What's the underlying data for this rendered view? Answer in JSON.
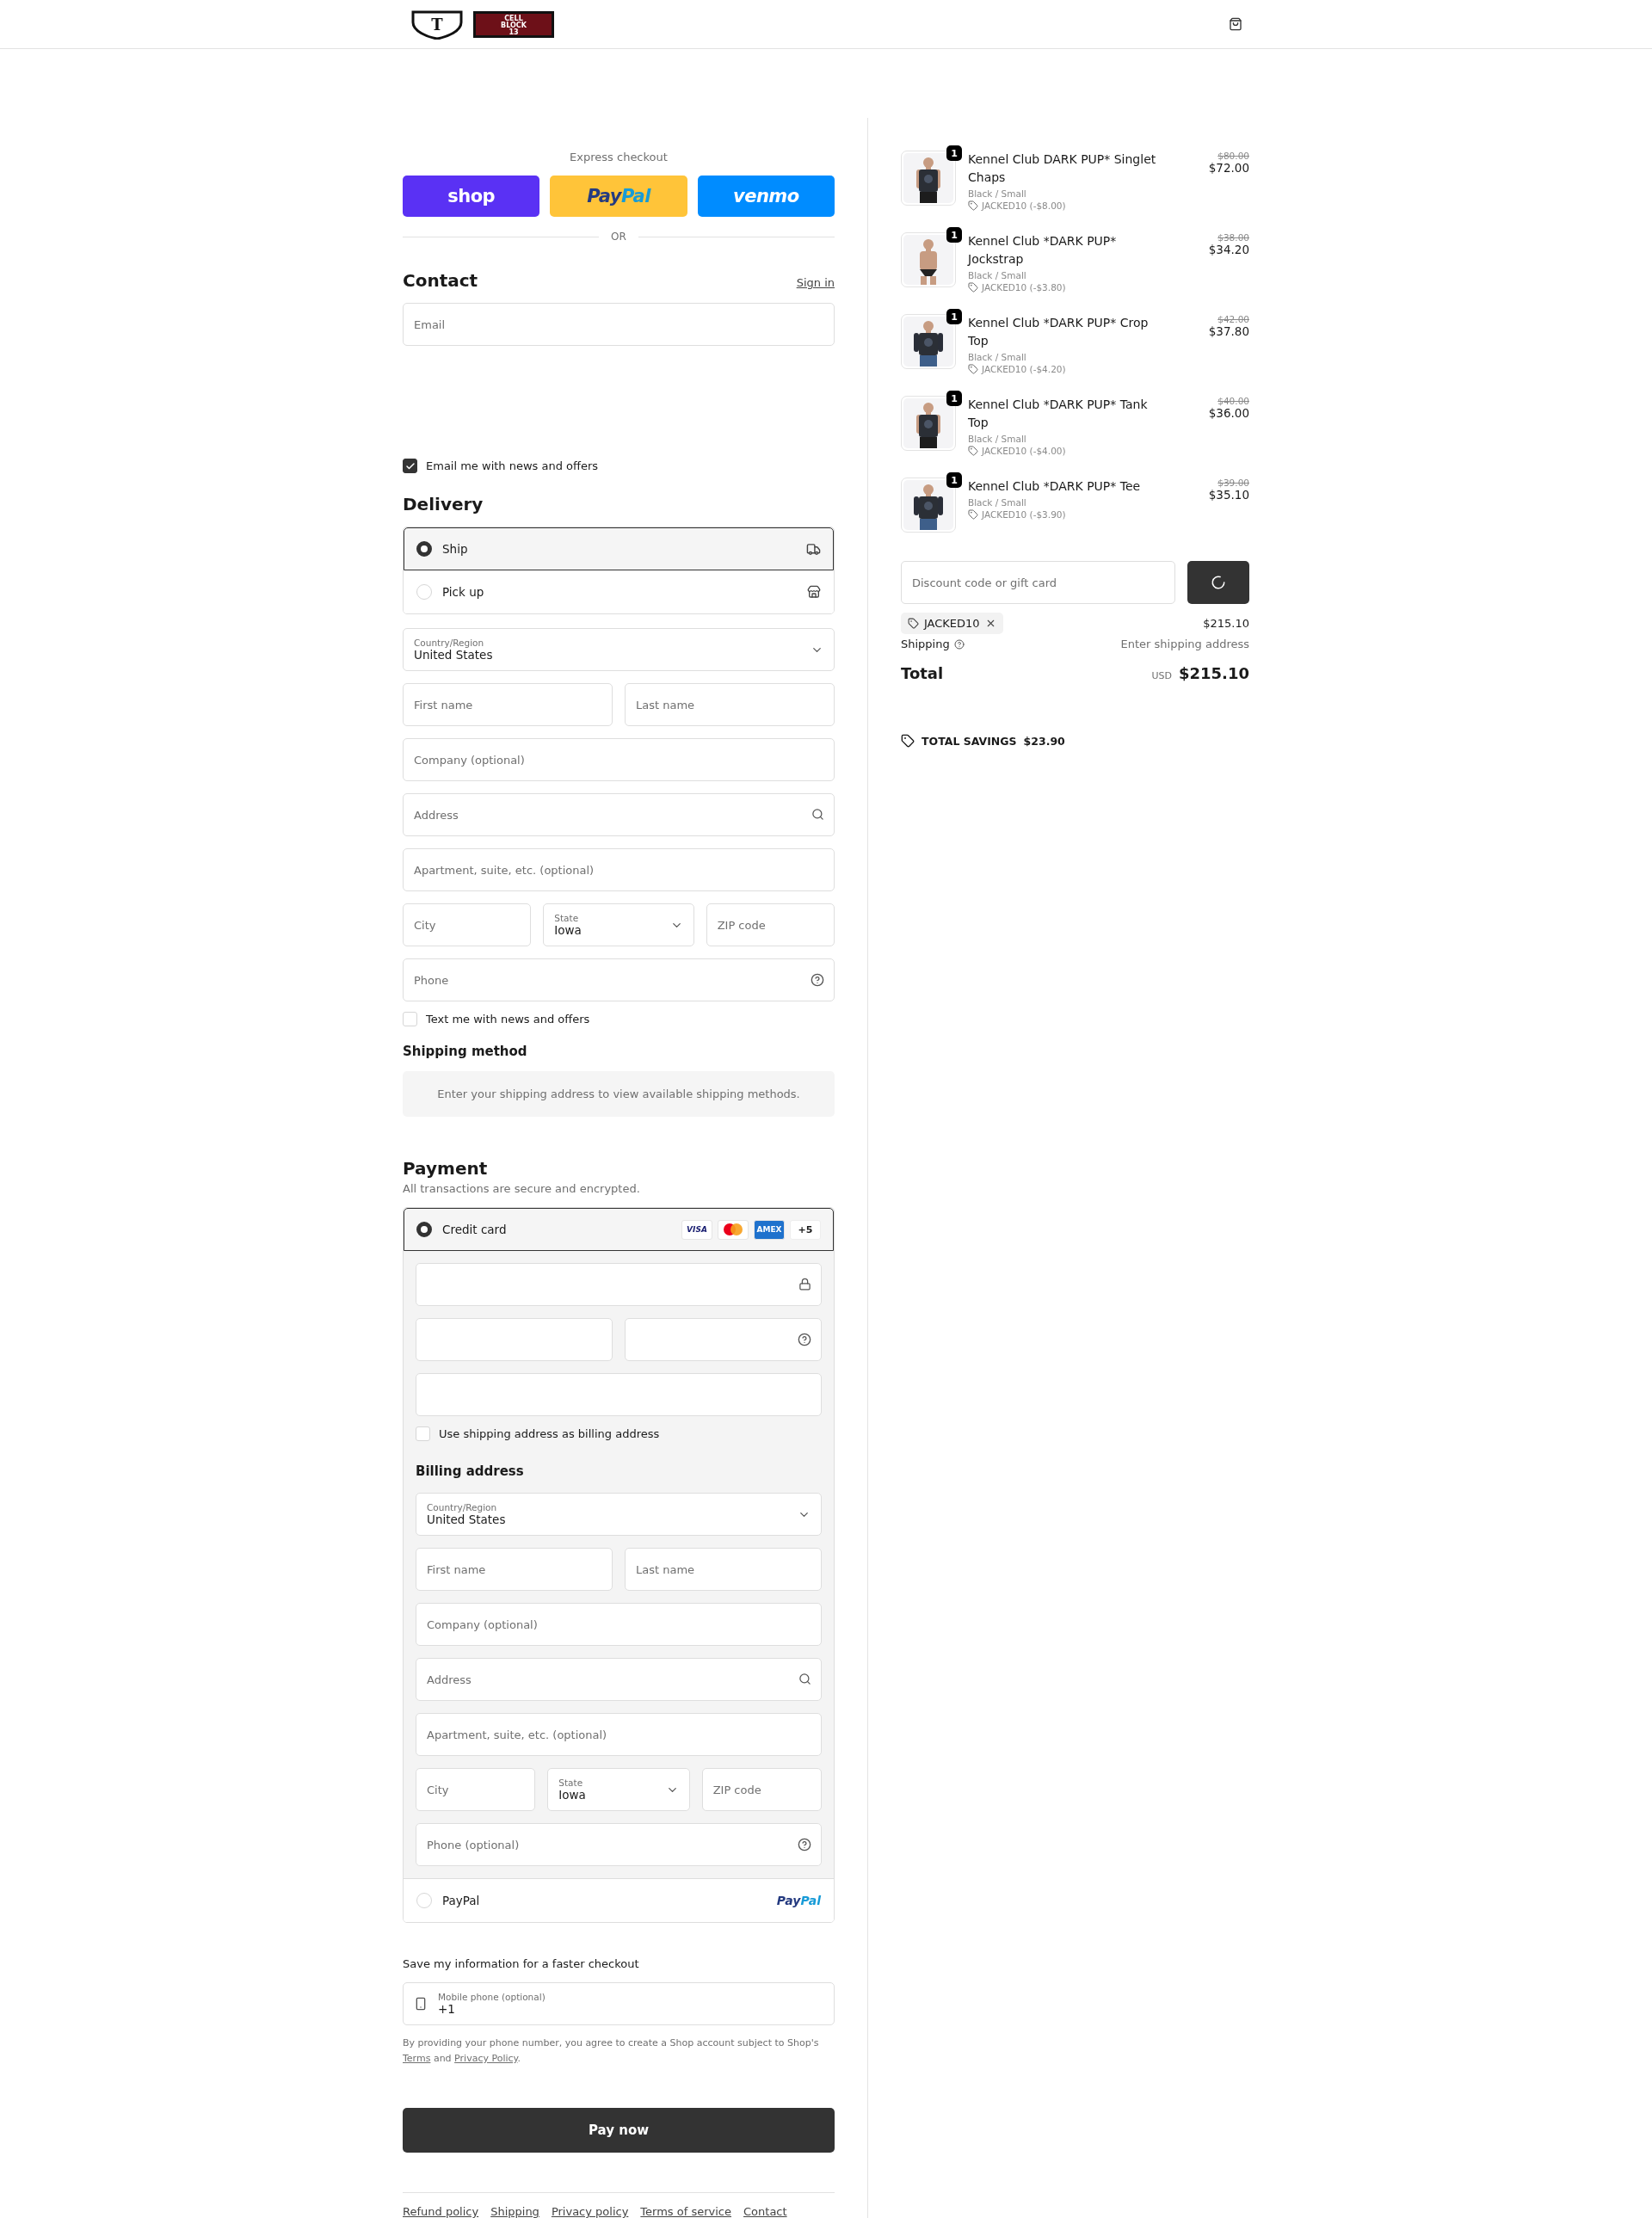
{
  "header": {
    "logo": {
      "emblem": "T",
      "badge": [
        "CELL",
        "BLOCK",
        "13"
      ]
    }
  },
  "express_checkout": {
    "title": "Express checkout",
    "buttons": [
      {
        "kind": "shop",
        "parts": [
          "shop"
        ]
      },
      {
        "kind": "paypal",
        "parts": [
          "Pay",
          "Pal"
        ]
      },
      {
        "kind": "venmo",
        "parts": [
          "venmo"
        ]
      }
    ],
    "divider": "OR"
  },
  "contact": {
    "title": "Contact",
    "sign_in": "Sign in",
    "email": {
      "placeholder": "Email"
    },
    "offers": {
      "label": "Email me with news and offers",
      "checked": true
    }
  },
  "delivery": {
    "title": "Delivery",
    "options": [
      {
        "label": "Ship",
        "kind": "ship",
        "selected": true
      },
      {
        "label": "Pick up",
        "kind": "pickup",
        "selected": false
      }
    ],
    "rows": [
      [
        {
          "kind": "select",
          "label": "Country/Region",
          "value": "United States"
        }
      ],
      [
        {
          "kind": "text",
          "placeholder": "First name"
        },
        {
          "kind": "text",
          "placeholder": "Last name"
        }
      ],
      [
        {
          "kind": "text",
          "placeholder": "Company (optional)"
        }
      ],
      [
        {
          "kind": "search",
          "placeholder": "Address"
        }
      ],
      [
        {
          "kind": "text",
          "placeholder": "Apartment, suite, etc. (optional)"
        }
      ],
      [
        {
          "kind": "text",
          "placeholder": "City"
        },
        {
          "kind": "select",
          "label": "State",
          "value": "Iowa"
        },
        {
          "kind": "text",
          "placeholder": "ZIP code"
        }
      ],
      [
        {
          "kind": "help",
          "placeholder": "Phone"
        }
      ]
    ],
    "text_offers": {
      "label": "Text me with news and offers",
      "checked": false
    }
  },
  "shipping_method": {
    "title": "Shipping method",
    "message": "Enter your shipping address to view available shipping methods."
  },
  "payment": {
    "title": "Payment",
    "subtitle": "All transactions are secure and encrypted.",
    "methods": [
      {
        "kind": "card",
        "label": "Credit card",
        "selected": true,
        "brands": [
          {
            "kind": "visa",
            "label": "VISA"
          },
          {
            "kind": "mastercard"
          },
          {
            "kind": "amex",
            "label": "AMEX"
          }
        ],
        "more": "+5"
      },
      {
        "kind": "paypal",
        "label": "PayPal",
        "selected": false,
        "logo": [
          "Pay",
          "Pal"
        ]
      }
    ],
    "card_rows": [
      [
        {
          "kind": "lock"
        }
      ],
      [
        {
          "kind": "text"
        },
        {
          "kind": "help"
        }
      ],
      [
        {
          "kind": "text"
        }
      ]
    ],
    "same_as_shipping": {
      "label": "Use shipping address as billing address",
      "checked": false
    },
    "billing": {
      "title": "Billing address",
      "rows": [
        [
          {
            "kind": "select",
            "label": "Country/Region",
            "value": "United States"
          }
        ],
        [
          {
            "kind": "text",
            "placeholder": "First name"
          },
          {
            "kind": "text",
            "placeholder": "Last name"
          }
        ],
        [
          {
            "kind": "text",
            "placeholder": "Company (optional)"
          }
        ],
        [
          {
            "kind": "search",
            "placeholder": "Address"
          }
        ],
        [
          {
            "kind": "text",
            "placeholder": "Apartment, suite, etc. (optional)"
          }
        ],
        [
          {
            "kind": "text",
            "placeholder": "City"
          },
          {
            "kind": "select",
            "label": "State",
            "value": "Iowa"
          },
          {
            "kind": "text",
            "placeholder": "ZIP code"
          }
        ],
        [
          {
            "kind": "help",
            "placeholder": "Phone (optional)"
          }
        ]
      ]
    }
  },
  "remember_me": {
    "title": "Save my information for a faster checkout",
    "phone": {
      "label": "Mobile phone (optional)",
      "value": "+1"
    },
    "disclaimer": {
      "before": "By providing your phone number, you agree to create a Shop account subject to Shop's",
      "terms": "Terms",
      "middle": "and",
      "privacy": "Privacy Policy",
      "after": "."
    }
  },
  "pay_button": "Pay now",
  "footer_links": [
    "Refund policy",
    "Shipping",
    "Privacy policy",
    "Terms of service",
    "Contact"
  ],
  "summary": {
    "items": [
      {
        "quantity": "1",
        "name": "Kennel Club DARK PUP* Singlet Chaps",
        "variant": "Black / Small",
        "discount": "JACKED10 (-$8.00)",
        "original_price": "$80.00",
        "price": "$72.00",
        "kind": "singlet"
      },
      {
        "quantity": "1",
        "name": "Kennel Club *DARK PUP* Jockstrap",
        "variant": "Black / Small",
        "discount": "JACKED10 (-$3.80)",
        "original_price": "$38.00",
        "price": "$34.20",
        "kind": "jock"
      },
      {
        "quantity": "1",
        "name": "Kennel Club *DARK PUP* Crop Top",
        "variant": "Black / Small",
        "discount": "JACKED10 (-$4.20)",
        "original_price": "$42.00",
        "price": "$37.80",
        "kind": "tee"
      },
      {
        "quantity": "1",
        "name": "Kennel Club *DARK PUP* Tank Top",
        "variant": "Black / Small",
        "discount": "JACKED10 (-$4.00)",
        "original_price": "$40.00",
        "price": "$36.00",
        "kind": "singlet"
      },
      {
        "quantity": "1",
        "name": "Kennel Club *DARK PUP* Tee",
        "variant": "Black / Small",
        "discount": "JACKED10 (-$3.90)",
        "original_price": "$39.00",
        "price": "$35.10",
        "kind": "tee"
      }
    ],
    "discount": {
      "placeholder": "Discount code or gift card"
    },
    "applied_code": "JACKED10",
    "subtotal": "$215.10",
    "shipping": {
      "label": "Shipping",
      "value": "Enter shipping address"
    },
    "total": {
      "label": "Total",
      "currency": "USD",
      "value": "$215.10"
    },
    "savings": {
      "label": "TOTAL SAVINGS",
      "value": "$23.90"
    }
  }
}
